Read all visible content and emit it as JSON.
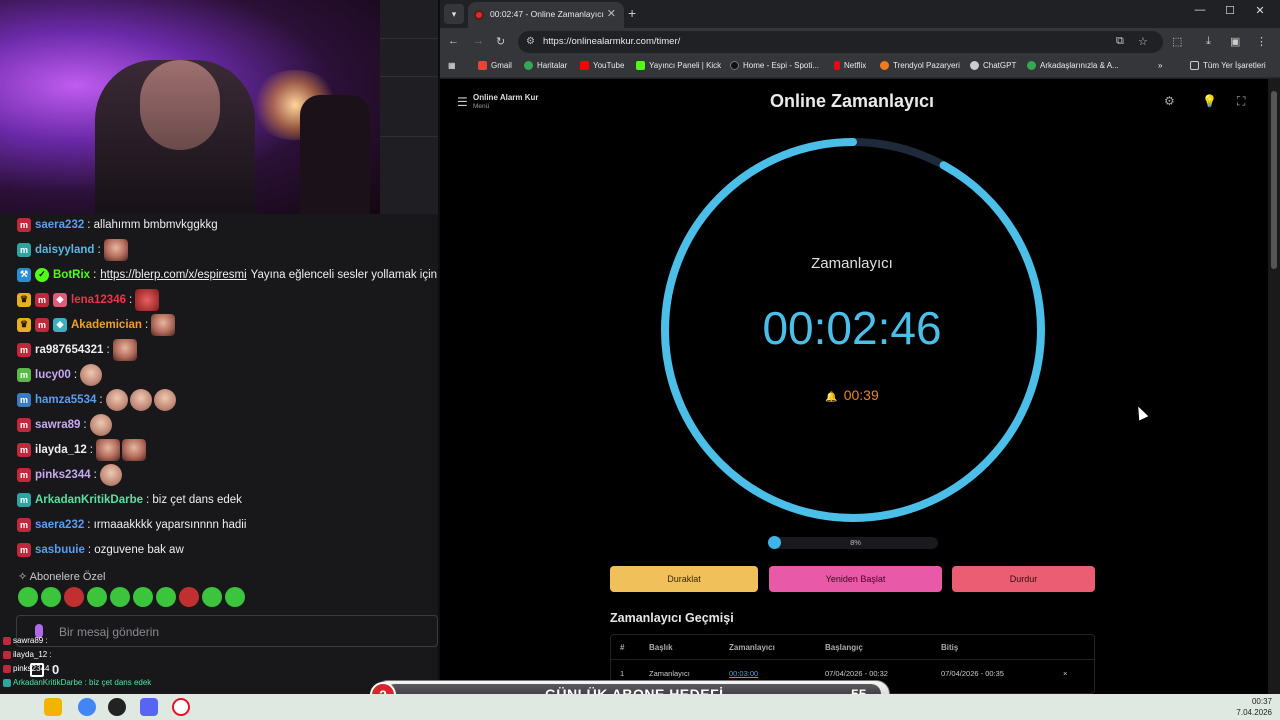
{
  "browser": {
    "tab_title": "00:02:47 - Online Zamanlayıcı",
    "url": "https://onlinealarmkur.com/timer/",
    "bookmarks": [
      "Gmail",
      "Haritalar",
      "YouTube",
      "Yayıncı Paneli | Kick",
      "Home - Espi - Spoti...",
      "Netflix",
      "Trendyol Pazaryeri",
      "ChatGPT",
      "Arkadaşlarınızla & A..."
    ],
    "all_bookmarks": "Tüm Yer İşaretleri"
  },
  "page": {
    "menu_title": "Online Alarm Kur",
    "menu_sub": "Menü",
    "title": "Online Zamanlayıcı",
    "timer_label": "Zamanlayıcı",
    "timer_value": "00:02:46",
    "alarm_value": "00:39",
    "progress_percent": 8,
    "progress_label": "8%",
    "buttons": {
      "pause": "Duraklat",
      "restart": "Yeniden Başlat",
      "stop": "Durdur"
    },
    "history": {
      "title": "Zamanlayıcı Geçmişi",
      "headers": [
        "#",
        "Başlık",
        "Zamanlayıcı",
        "Başlangıç",
        "Bitiş"
      ],
      "rows": [
        {
          "num": "1",
          "name": "Zamanlayıcı",
          "duration": "00:03:00",
          "start": "07/04/2026 - 00:32",
          "end": "07/04/2026 - 00:35",
          "remove": "×"
        }
      ]
    }
  },
  "chat": {
    "messages": [
      {
        "user": "saera232",
        "color": "#5a9ef0",
        "text": ": allahımm bmbmvkggkkg"
      },
      {
        "user": "daisyyland",
        "color": "#5ab8e8",
        "text": ":"
      },
      {
        "user": "BotRix",
        "color": "#53fc18",
        "text": ":",
        "link": "https://blerp.com/x/espiresmi",
        "after": "Yayına eğlenceli sesler yollamak için"
      },
      {
        "user": "lena12346",
        "color": "#e8364a",
        "text": ":"
      },
      {
        "user": "Akademician",
        "color": "#f0a02a",
        "text": ":"
      },
      {
        "user": "ra987654321",
        "color": "#efeff1",
        "text": ":"
      },
      {
        "user": "lucy00",
        "color": "#c8a8f0",
        "text": ":"
      },
      {
        "user": "hamza5534",
        "color": "#5a9ef0",
        "text": ":"
      },
      {
        "user": "sawra89",
        "color": "#c8a8f0",
        "text": ":"
      },
      {
        "user": "ilayda_12",
        "color": "#efeff1",
        "text": ":"
      },
      {
        "user": "pinks2344",
        "color": "#c8a8f0",
        "text": ":"
      },
      {
        "user": "ArkadanKritikDarbe",
        "color": "#5ae0a0",
        "text": ": biz çet dans edek"
      },
      {
        "user": "saera232",
        "color": "#5a9ef0",
        "text": ": ırmaaakkkk yaparsınnnn hadii"
      },
      {
        "user": "sasbuuie",
        "color": "#5a9ef0",
        "text": ": ozguvene bak aw"
      }
    ],
    "sub_emotes_title": "Abonelere Özel",
    "input_placeholder": "Bir mesaj gönderin",
    "mini": [
      "sawra89 :",
      "ilayda_12 :",
      "pinks2344 :",
      "ArkadanKritikDarbe : biz çet dans edek"
    ],
    "viewer_count": "0"
  },
  "goal": {
    "count": "2",
    "title": "GÜNLÜK ABONE HEDEFİ",
    "target": "55"
  },
  "taskbar": {
    "time": "00:37",
    "date": "7.04.2026"
  }
}
